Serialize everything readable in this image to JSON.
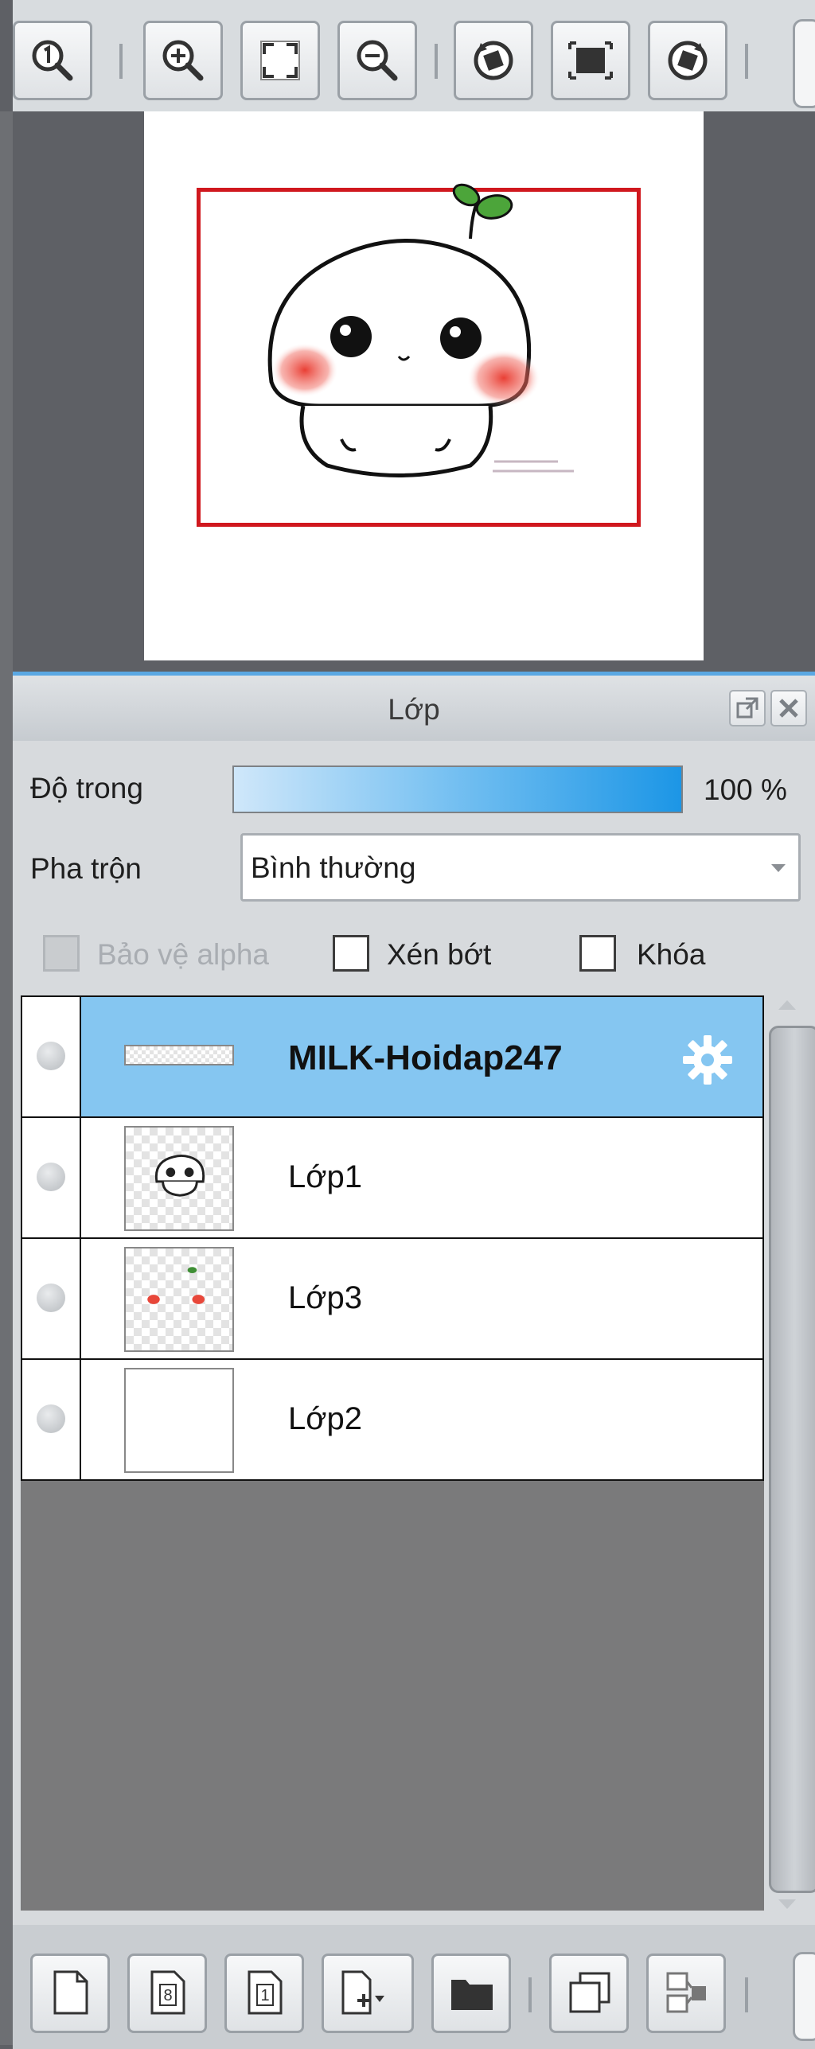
{
  "navigator": {
    "toolbar": {
      "buttons": [
        {
          "name": "actual-size",
          "icon": "zoom-actual-size-icon"
        },
        {
          "name": "zoom-in",
          "icon": "zoom-in-icon"
        },
        {
          "name": "fit-window",
          "icon": "fit-to-window-icon"
        },
        {
          "name": "zoom-out",
          "icon": "zoom-out-icon"
        },
        {
          "name": "rotate-left",
          "icon": "rotate-left-icon"
        },
        {
          "name": "reset-view",
          "icon": "reset-view-icon"
        },
        {
          "name": "rotate-right",
          "icon": "rotate-right-icon"
        }
      ]
    },
    "preview": {
      "frame_color": "#d0181e"
    }
  },
  "layer_panel": {
    "title": "Lớp",
    "opacity": {
      "label": "Độ trong",
      "value": 100,
      "value_text": "100 %"
    },
    "blend": {
      "label": "Pha trộn",
      "value": "Bình thường"
    },
    "options": {
      "protect_alpha": {
        "label": "Bảo vệ alpha",
        "checked": false,
        "enabled": false
      },
      "clipping": {
        "label": "Xén bớt",
        "checked": false
      },
      "lock": {
        "label": "Khóa",
        "checked": false
      }
    },
    "layers": [
      {
        "name": "MILK-Hoidap247",
        "selected": true,
        "kind": "text-strip",
        "settings_icon": "gear-icon"
      },
      {
        "name": "Lớp1",
        "selected": false,
        "kind": "face"
      },
      {
        "name": "Lớp3",
        "selected": false,
        "kind": "blush"
      },
      {
        "name": "Lớp2",
        "selected": false,
        "kind": "white"
      }
    ],
    "bottom_toolbar": {
      "buttons": [
        {
          "name": "new-layer",
          "icon": "new-layer-icon"
        },
        {
          "name": "new-8bit-layer",
          "icon": "new-8bit-layer-icon"
        },
        {
          "name": "new-1bit-layer",
          "icon": "new-1bit-layer-icon"
        },
        {
          "name": "add-layer-menu",
          "icon": "add-layer-dropdown-icon"
        },
        {
          "name": "new-folder",
          "icon": "folder-icon"
        },
        {
          "name": "duplicate-layer",
          "icon": "duplicate-layer-icon"
        },
        {
          "name": "merge-down",
          "icon": "merge-down-icon"
        }
      ]
    },
    "colors": {
      "selection": "#85c6f1",
      "accent": "#5aa8e3"
    }
  }
}
